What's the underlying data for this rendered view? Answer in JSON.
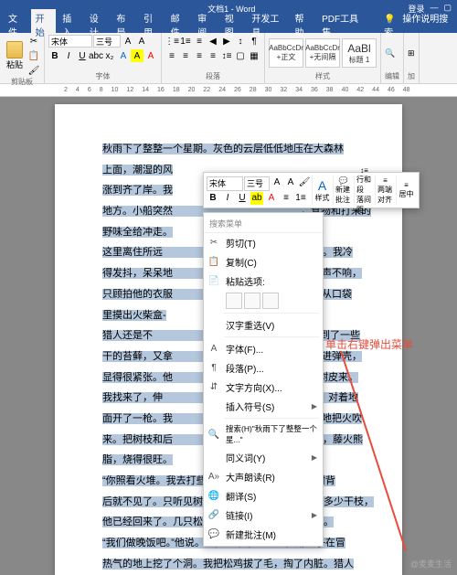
{
  "titlebar": {
    "title": "文档1 - Word",
    "login": "登录",
    "help_hint": "操作说明搜索"
  },
  "menubar": {
    "items": [
      "文件",
      "开始",
      "插入",
      "设计",
      "布局",
      "引用",
      "邮件",
      "审阅",
      "视图",
      "开发工具",
      "帮助",
      "PDF工具集"
    ]
  },
  "ribbon": {
    "clipboard": {
      "label": "剪贴板",
      "paste": "粘贴"
    },
    "font": {
      "label": "字体",
      "name": "宋体",
      "size": "三号",
      "b": "B",
      "i": "I",
      "u": "U"
    },
    "paragraph": {
      "label": "段落"
    },
    "styles": {
      "label": "样式",
      "s1": "AaBbCcDr",
      "s2": "AaBbCcDr",
      "s3": "AaBl",
      "n1": "+正文",
      "n2": "+无间隔",
      "n3": "标题 1"
    },
    "editing": {
      "label": "编辑"
    },
    "addins": {
      "label": "加"
    }
  },
  "ruler": [
    "2",
    "4",
    "6",
    "8",
    "10",
    "12",
    "14",
    "16",
    "18",
    "20",
    "22",
    "24",
    "26",
    "28",
    "30",
    "32",
    "34",
    "36",
    "38",
    "40",
    "42",
    "44",
    "46",
    "48"
  ],
  "document": {
    "p1": "秋雨下了整整一个星期。灰色的云层低低地压在大森林",
    "p2": "上面，潮湿的风",
    "p3": "涨到齐了岸。我",
    "p4": "地方。小船突然",
    "p5": "野味全给冲走。",
    "p6": "这里离住所远",
    "p7": "得发抖，呆呆地",
    "p8": "只顾拍他的衣服",
    "p9": "里摸出火柴盒-",
    "p10": "猎人还是不",
    "p11": "干的苔藓，又拿",
    "p12": "显得很紧张。他",
    "p13": "我找来了，伸",
    "p14": "面开了一枪。我",
    "p15": "来。把树枝和后",
    "p16": "脂，烧得很旺。",
    "p2b": "，食物和打来的",
    "p6b": "里又累又饿。我冷",
    "p7b": "猎人不声不响，",
    "p8b": "。可是从口袋",
    "p10b": "缝里找到了一些",
    "p11b": "苔藓塞进弹壳，",
    "p12b": "和树皮来。",
    "p13b": "弹壳，对着地",
    "p14b": "他小心地把火吹",
    "p15b": "了一会儿，藤火熊",
    "p17": "“你照看火堆。我去打些野味来。”猎人说着，转到树背",
    "p18": "后就不见了。只听见树林里响了几枪。我还没捡到多少干枝，",
    "p19": "他已经回来了。几只松鸡挂在他腰上，摇摇晃晃的。",
    "p20": "“我们做晚饭吧。”他说。他把火堆移到一边，用刀子在冒",
    "p21": "热气的地上挖了个洞。我把松鸡拔了毛，掏了内脏。猎人"
  },
  "mini_toolbar": {
    "font": "宋体",
    "size": "三号",
    "style": "样式",
    "new_comment": "新建\n批注",
    "spacing": "行和段\n落间距",
    "align": "两端对齐",
    "center": "居中"
  },
  "context_menu": {
    "search_ph": "搜索菜单",
    "cut": "剪切(T)",
    "copy": "复制(C)",
    "paste_opts": "粘贴选项:",
    "cn_reconv": "汉字重选(V)",
    "font": "字体(F)...",
    "para": "段落(P)...",
    "textdir": "文字方向(X)...",
    "symbol": "插入符号(S)",
    "search": "搜索(H)\"秋雨下了整整一个星...\"",
    "synonym": "同义词(Y)",
    "read": "大声朗读(R)",
    "translate": "翻译(S)",
    "link": "链接(I)",
    "new_comment": "新建批注(M)"
  },
  "annotation": "单击右键弹出菜单",
  "watermark": "@麦麦生活"
}
